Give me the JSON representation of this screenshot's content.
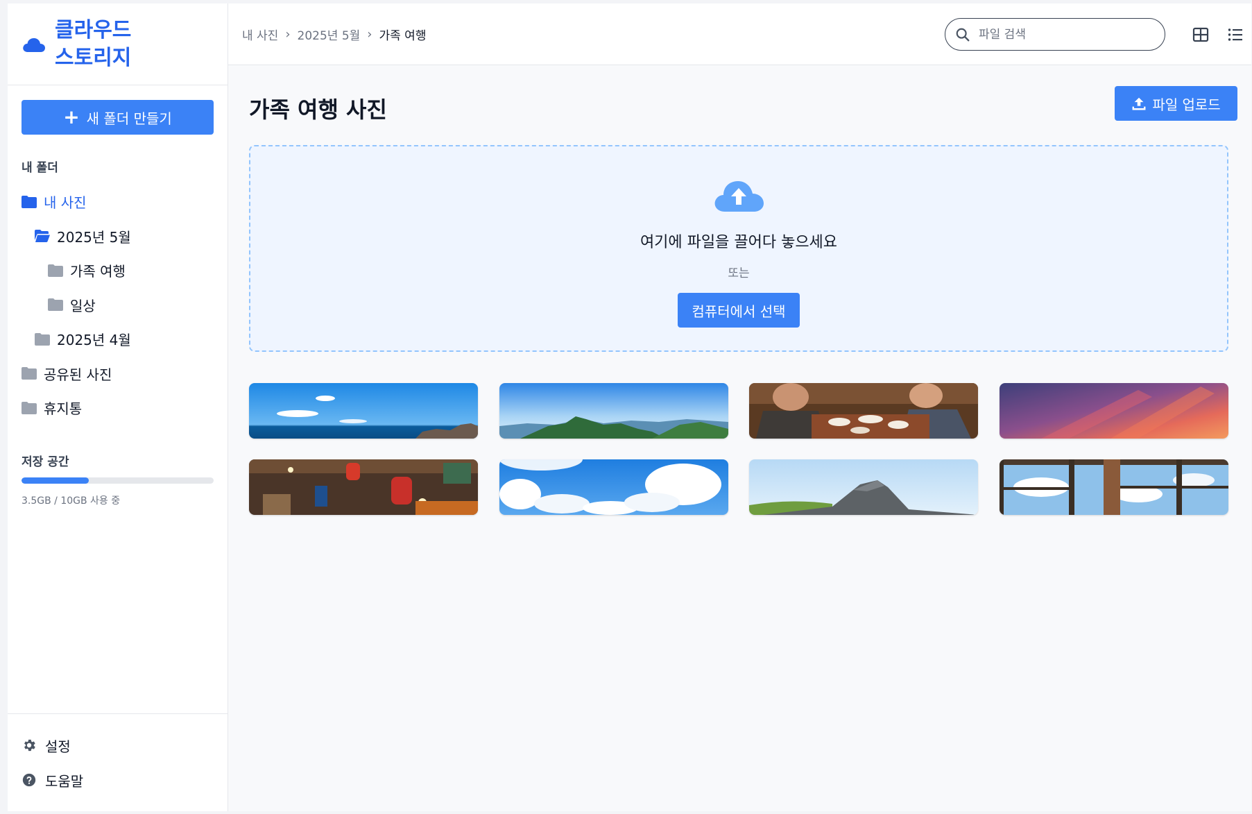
{
  "app": {
    "title": "클라우드 스토리지"
  },
  "sidebar": {
    "new_folder_label": "새 폴더 만들기",
    "section_label": "내 폴더",
    "tree": [
      {
        "label": "내 사진"
      },
      {
        "label": "2025년 5월"
      },
      {
        "label": "가족 여행"
      },
      {
        "label": "일상"
      },
      {
        "label": "2025년 4월"
      },
      {
        "label": "공유된 사진"
      },
      {
        "label": "휴지통"
      }
    ],
    "storage": {
      "label": "저장 공간",
      "used_fraction": 0.35,
      "text": "3.5GB / 10GB 사용 중"
    },
    "bottom": [
      {
        "label": "설정",
        "icon": "gear-icon"
      },
      {
        "label": "도움말",
        "icon": "help-icon"
      }
    ]
  },
  "header": {
    "breadcrumb": [
      "내 사진",
      "2025년 5월",
      "가족 여행"
    ],
    "search_placeholder": "파일 검색"
  },
  "main": {
    "title": "가족 여행 사진",
    "upload_label": "파일 업로드",
    "dropzone": {
      "text": "여기에 파일을 끌어다 놓으세요",
      "or": "또는",
      "button": "컴퓨터에서 선택"
    },
    "photos": [
      {
        "subject": "ocean horizon"
      },
      {
        "subject": "mountain range"
      },
      {
        "subject": "family dinner"
      },
      {
        "subject": "sunset sky"
      },
      {
        "subject": "market street"
      },
      {
        "subject": "clouds"
      },
      {
        "subject": "rock on hill"
      },
      {
        "subject": "window view"
      }
    ]
  },
  "colors": {
    "accent": "#3b82f6",
    "brand": "#2563eb",
    "folder": "#9ca3af",
    "active_folder": "#2563eb"
  }
}
